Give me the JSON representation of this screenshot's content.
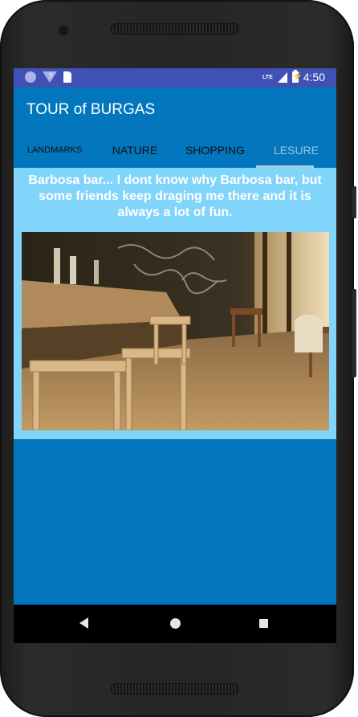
{
  "status_bar": {
    "time": "4:50",
    "network": "LTE",
    "icons": [
      "notification-dot-icon",
      "wifi-icon",
      "sd-card-icon",
      "signal-icon",
      "battery-icon"
    ]
  },
  "app_bar": {
    "title": "TOUR of BURGAS"
  },
  "tabs": [
    {
      "label": "LANDMARKS",
      "selected": false
    },
    {
      "label": "NATURE",
      "selected": false
    },
    {
      "label": "SHOPPING",
      "selected": false
    },
    {
      "label": "LESURE",
      "selected": true
    }
  ],
  "card": {
    "description": "Barbosa bar... I dont know why Barbosa bar, but some friends keep draging me there and it is always a lot of fun.",
    "image": "bar-interior-photo"
  },
  "nav_bar": {
    "buttons": [
      "back-icon",
      "home-icon",
      "recents-icon"
    ]
  },
  "colors": {
    "status_bar": "#3f51b5",
    "primary": "#0277bd",
    "card_background": "#81d4fa",
    "selected_tab": "#9dc2dc"
  }
}
